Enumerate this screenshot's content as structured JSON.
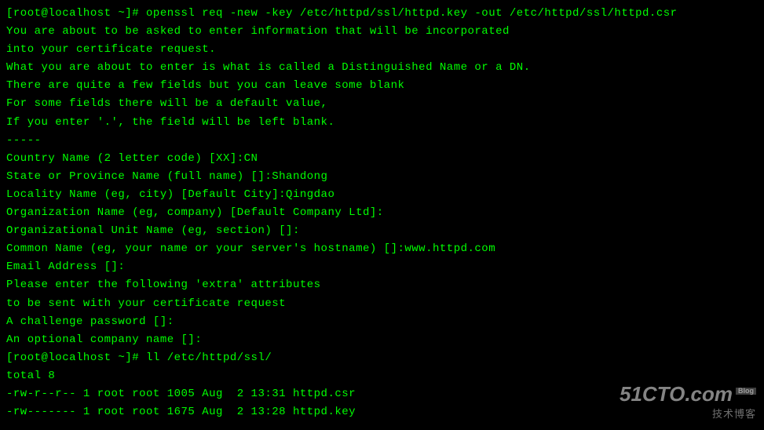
{
  "lines": {
    "l0": "[root@localhost ~]# openssl req -new -key /etc/httpd/ssl/httpd.key -out /etc/httpd/ssl/httpd.csr",
    "l1": "You are about to be asked to enter information that will be incorporated",
    "l2": "into your certificate request.",
    "l3": "What you are about to enter is what is called a Distinguished Name or a DN.",
    "l4": "There are quite a few fields but you can leave some blank",
    "l5": "For some fields there will be a default value,",
    "l6": "If you enter '.', the field will be left blank.",
    "l7": "-----",
    "l8": "Country Name (2 letter code) [XX]:CN",
    "l9": "State or Province Name (full name) []:Shandong",
    "l10": "Locality Name (eg, city) [Default City]:Qingdao",
    "l11": "Organization Name (eg, company) [Default Company Ltd]:",
    "l12": "Organizational Unit Name (eg, section) []:",
    "l13": "Common Name (eg, your name or your server's hostname) []:www.httpd.com",
    "l14": "Email Address []:",
    "l15": "",
    "l16": "Please enter the following 'extra' attributes",
    "l17": "to be sent with your certificate request",
    "l18": "A challenge password []:",
    "l19": "An optional company name []:",
    "l20": "[root@localhost ~]# ll /etc/httpd/ssl/",
    "l21": "total 8",
    "l22": "-rw-r--r-- 1 root root 1005 Aug  2 13:31 httpd.csr",
    "l23": "-rw------- 1 root root 1675 Aug  2 13:28 httpd.key"
  },
  "watermark": {
    "main": "51CTO.com",
    "sub": "技术博客",
    "blog": "Blog"
  }
}
